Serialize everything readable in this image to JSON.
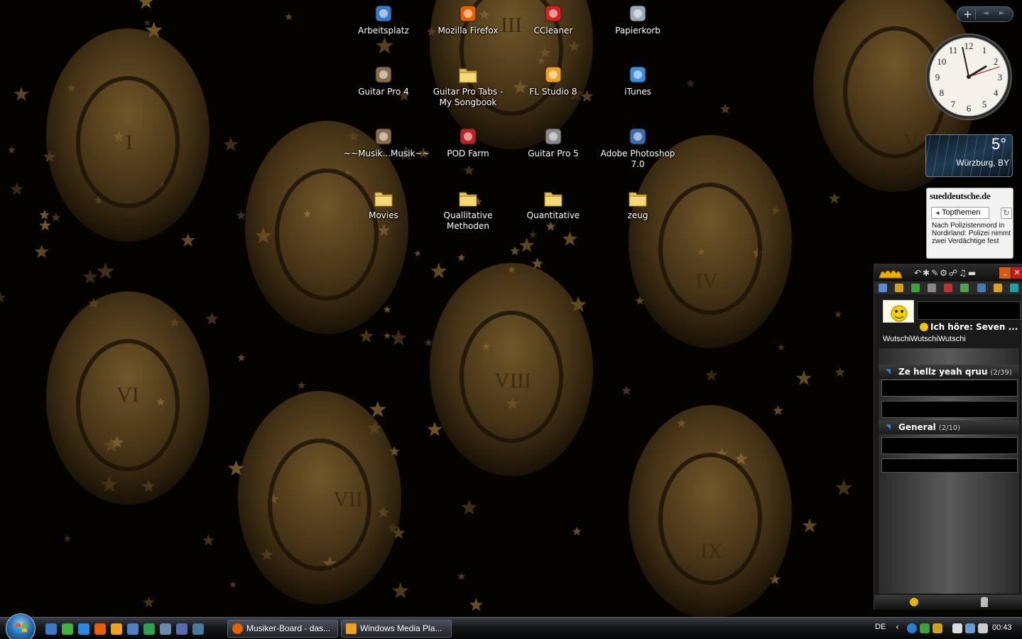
{
  "desktop": {
    "icons": [
      {
        "label": "Arbeitsplatz",
        "icon": "computer-icon",
        "color": "#3a78c8"
      },
      {
        "label": "Mozilla Firefox",
        "icon": "firefox-icon",
        "color": "#e66000"
      },
      {
        "label": "CCleaner",
        "icon": "ccleaner-icon",
        "color": "#d42020"
      },
      {
        "label": "Papierkorb",
        "icon": "recycle-bin-icon",
        "color": "#9aaab8"
      },
      {
        "label": "Guitar Pro 4",
        "icon": "guitar-pro-icon",
        "color": "#8a6a4a"
      },
      {
        "label": "Guitar Pro Tabs - My Songbook",
        "icon": "folder-icon",
        "color": "#e8c25a"
      },
      {
        "label": "FL Studio 8",
        "icon": "fl-studio-icon",
        "color": "#f0a020"
      },
      {
        "label": "iTunes",
        "icon": "itunes-icon",
        "color": "#3a8ee0"
      },
      {
        "label": "~~Musik...Musik~~",
        "icon": "music-shortcut-icon",
        "color": "#8a6a4a"
      },
      {
        "label": "POD Farm",
        "icon": "pod-farm-icon",
        "color": "#c02020"
      },
      {
        "label": "Guitar Pro 5",
        "icon": "guitar-pro-icon",
        "color": "#8a8a8a"
      },
      {
        "label": "Adobe Photoshop 7.0",
        "icon": "photoshop-icon",
        "color": "#3a6cb0"
      },
      {
        "label": "Movies",
        "icon": "folder-icon",
        "color": "#e8c25a"
      },
      {
        "label": "Quallitative Methoden",
        "icon": "folder-icon",
        "color": "#e8c25a"
      },
      {
        "label": "Quantitative",
        "icon": "folder-icon",
        "color": "#e8c25a"
      },
      {
        "label": "zeug",
        "icon": "folder-icon",
        "color": "#e8c25a"
      }
    ],
    "wallpaper_numerals": [
      "I",
      "III",
      "V",
      "VI",
      "VIII",
      "VII",
      "IV",
      "IX"
    ]
  },
  "sidebar": {
    "add_label": "+",
    "nav_label": "◄ ►",
    "clock": {
      "hour": 1,
      "minute": 58,
      "second": 12
    },
    "weather": {
      "temperature": "5°",
      "location": "Würzburg, BY"
    },
    "news": {
      "brand": "sueddeutsche.de",
      "tab_label": "Topthemen",
      "headline": "Nach Polizistenmord in Nordirland: Polizei nimmt zwei Verdächtige fest"
    }
  },
  "messenger": {
    "status_text": "Ich höre: Seven ...",
    "username": "WutschiWutschiWutschi",
    "groups": [
      {
        "name": "Ze hellz yeah qruu",
        "count": "(2/39)"
      },
      {
        "name": "General",
        "count": "(2/10)"
      }
    ]
  },
  "taskbar": {
    "tasks": [
      {
        "label": "Musiker-Board - das...",
        "icon": "firefox-icon",
        "color": "#e66000"
      },
      {
        "label": "Windows Media Pla...",
        "icon": "media-player-icon",
        "color": "#f0a020"
      }
    ],
    "language": "DE",
    "time": "00:43"
  },
  "colors": {
    "wallpaper_gold": "#8c6a32",
    "taskbar": "#15171b"
  }
}
